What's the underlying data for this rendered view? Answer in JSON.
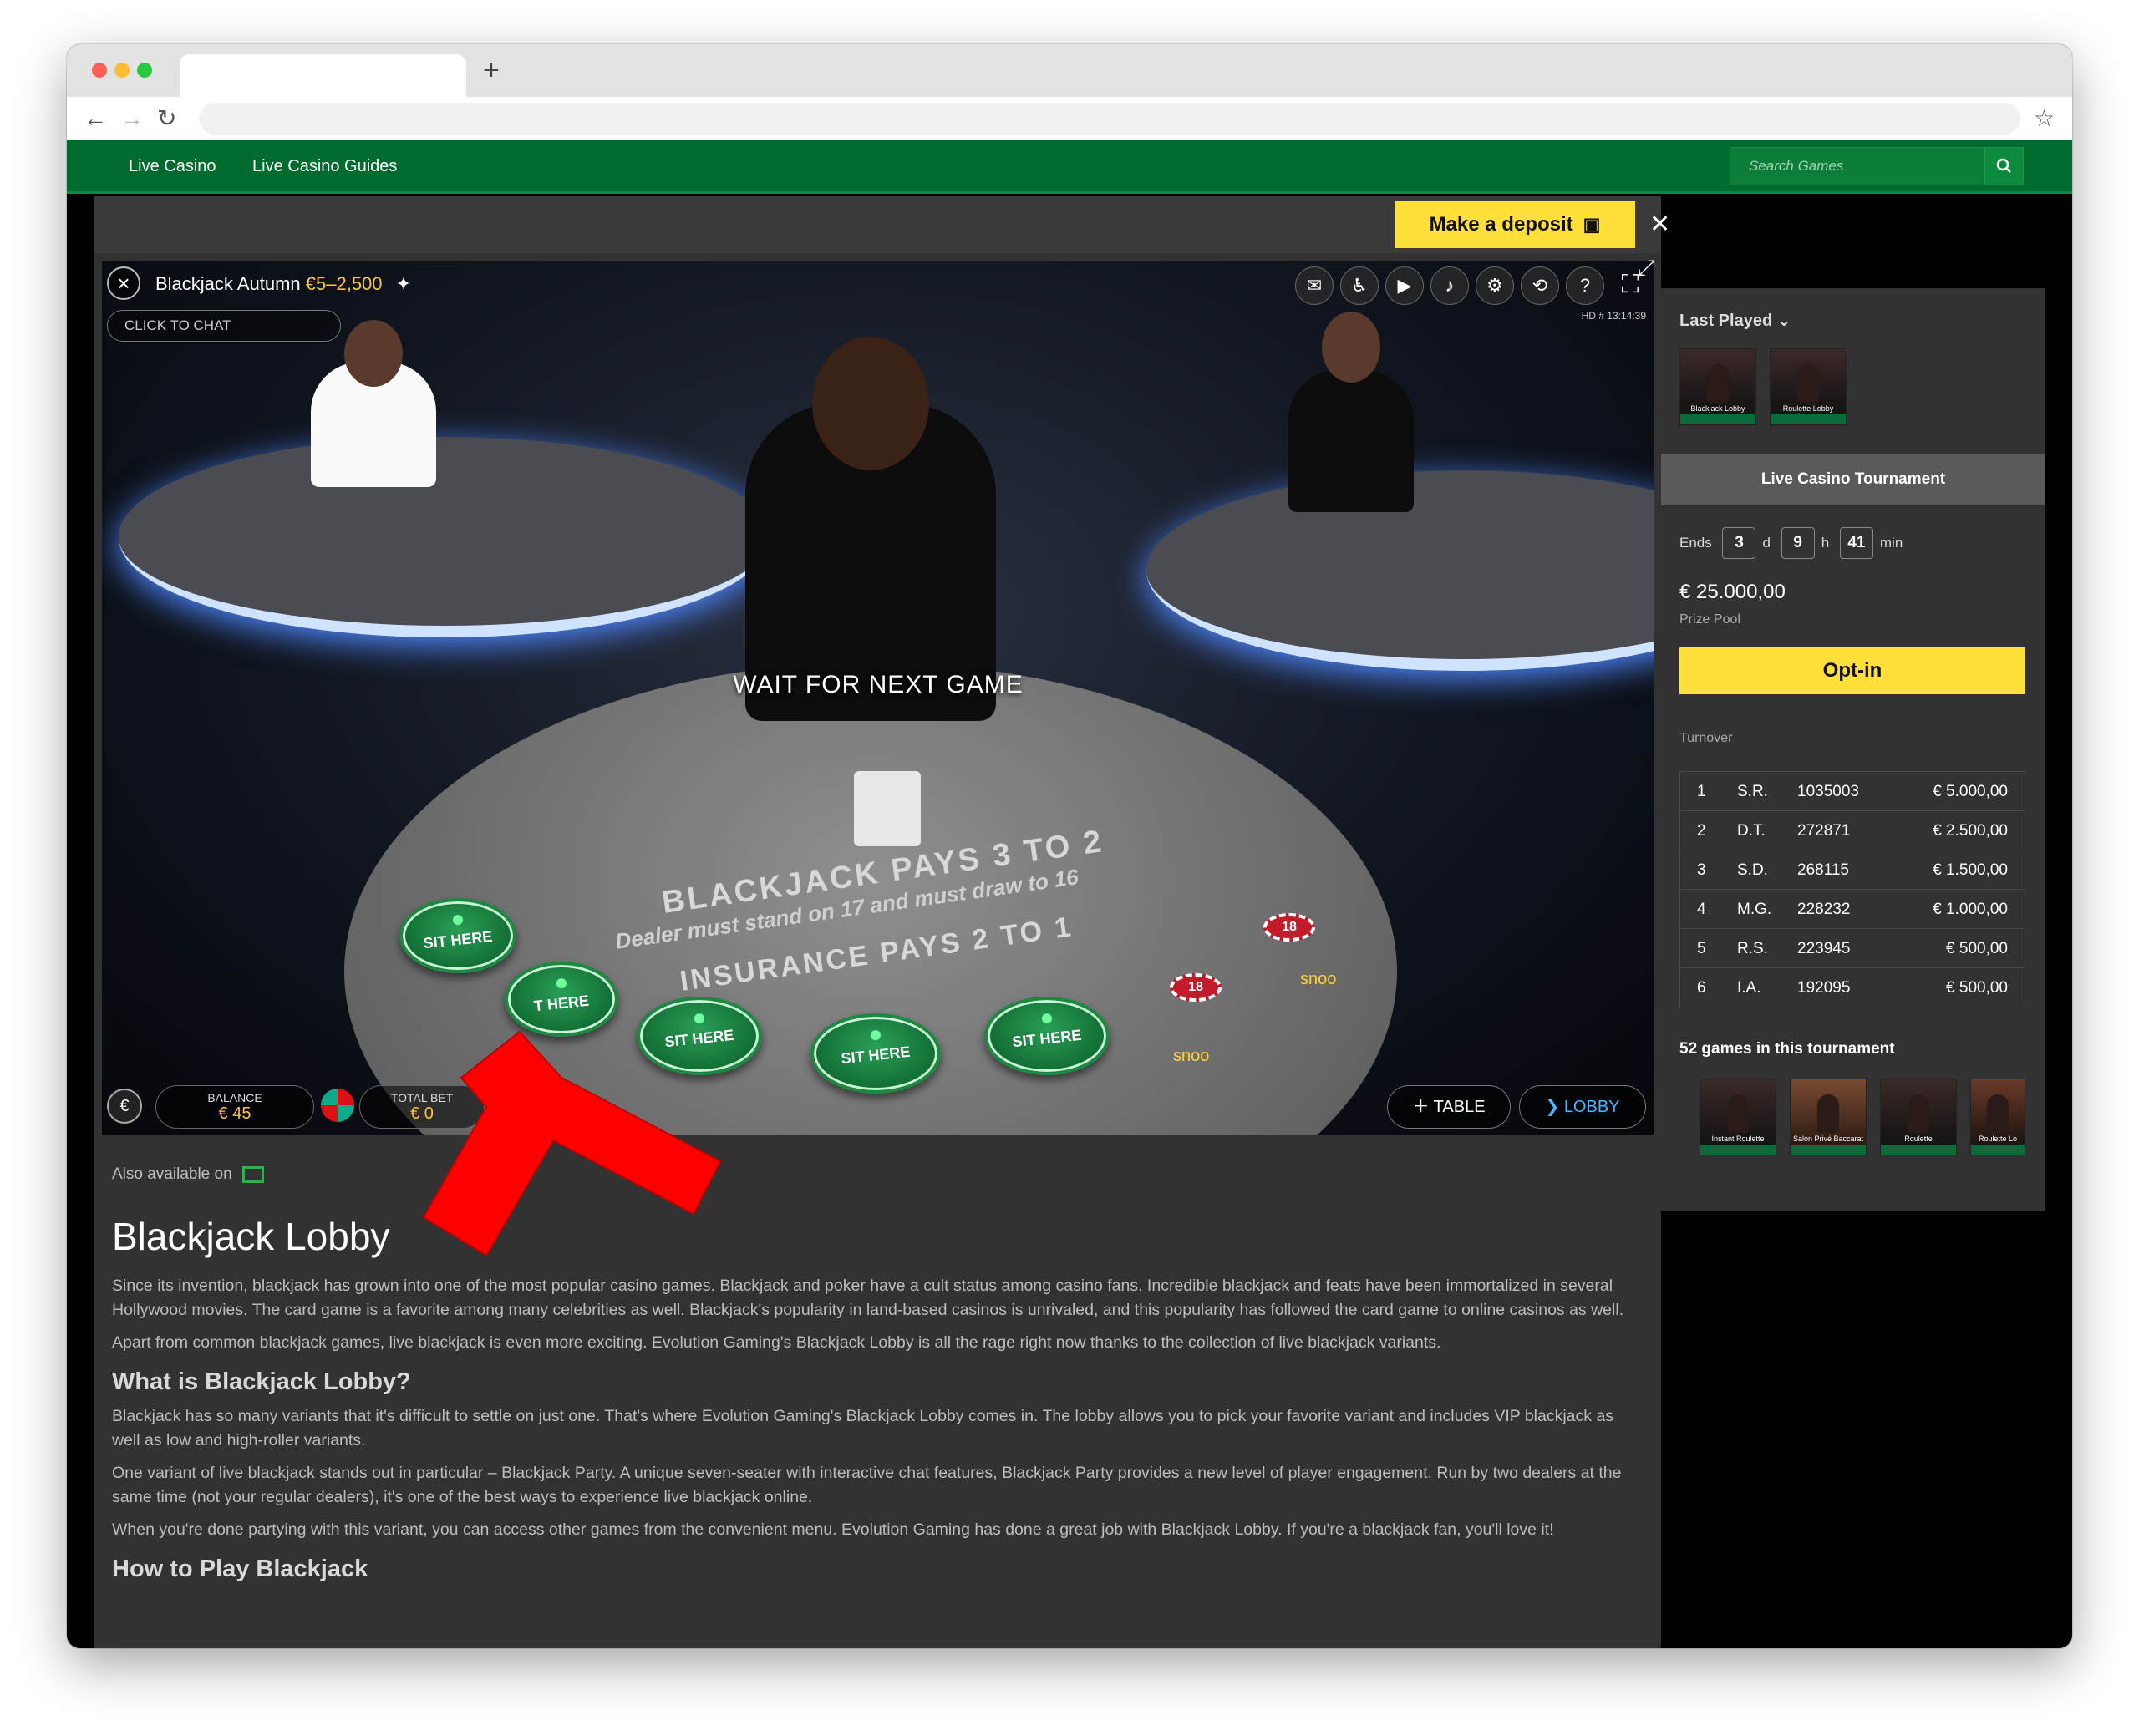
{
  "browser": {
    "new_tab_icon": "+",
    "back_icon": "←",
    "forward_icon": "→",
    "reload_icon": "↻",
    "bookmark_icon": "☆"
  },
  "site_nav": {
    "links": [
      "Live Casino",
      "Live Casino Guides"
    ],
    "search_placeholder": "Search Games",
    "search_icon": "search-icon"
  },
  "topbar": {
    "deposit_label": "Make a deposit",
    "close_icon": "✕"
  },
  "game": {
    "title": "Blackjack Autumn",
    "limits": "€5–2,500",
    "chat_placeholder": "CLICK TO CHAT",
    "hd_info": "HD  # 13:14:39",
    "status": "WAIT FOR NEXT GAME",
    "table_text_main": "BLACKJACK PAYS 3 TO 2",
    "table_text_rule": "Dealer must stand on 17 and must draw to 16",
    "table_text_ins": "INSURANCE PAYS 2 TO 1",
    "seat_label": "SIT HERE",
    "seat_partial_label": "T HERE",
    "chip_value": "18",
    "player_name": "snoo",
    "balance_label": "BALANCE",
    "balance_value": "€ 45",
    "total_bet_label": "TOTAL BET",
    "total_bet_value": "€ 0",
    "currency_icon": "€",
    "table_button": "TABLE",
    "lobby_button": "LOBBY"
  },
  "article": {
    "also_available": "Also available on",
    "title": "Blackjack Lobby",
    "p1": "Since its invention, blackjack has grown into one of the most popular casino games. Blackjack and poker have a cult status among casino fans. Incredible blackjack and feats have been immortalized in several Hollywood movies. The card game is a favorite among many celebrities as well. Blackjack's popularity in land-based casinos is unrivaled, and this popularity has followed the card game to online casinos as well.",
    "p2": "Apart from common blackjack games, live blackjack is even more exciting. Evolution Gaming's Blackjack Lobby is all the rage right now thanks to the collection of live blackjack variants.",
    "h2_1": "What is Blackjack Lobby?",
    "p3": "Blackjack has so many variants that it's difficult to settle on just one. That's where Evolution Gaming's Blackjack Lobby comes in. The lobby allows you to pick your favorite variant and includes VIP blackjack as well as low and high-roller variants.",
    "p4": "One variant of live blackjack stands out in particular – Blackjack Party. A unique seven-seater with interactive chat features, Blackjack Party provides a new level of player engagement. Run by two dealers at the same time (not your regular dealers), it's one of the best ways to experience live blackjack online.",
    "p5": "When you're done partying with this variant, you can access other games from the convenient menu. Evolution Gaming has done a great job with Blackjack Lobby. If you're a blackjack fan, you'll love it!",
    "h2_2": "How to Play Blackjack"
  },
  "sidebar": {
    "last_played": "Last Played",
    "last_played_items": [
      "Blackjack Lobby",
      "Roulette Lobby"
    ],
    "tournament_title": "Live Casino Tournament",
    "ends_label": "Ends",
    "days": "3",
    "days_unit": "d",
    "hours": "9",
    "hours_unit": "h",
    "minutes": "41",
    "minutes_unit": "min",
    "prize": "€ 25.000,00",
    "prize_label": "Prize Pool",
    "optin_label": "Opt-in",
    "turnover_label": "Turnover",
    "leaderboard": [
      {
        "rank": "1",
        "name": "S.R.",
        "id": "1035003",
        "amount": "€ 5.000,00"
      },
      {
        "rank": "2",
        "name": "D.T.",
        "id": "272871",
        "amount": "€ 2.500,00"
      },
      {
        "rank": "3",
        "name": "S.D.",
        "id": "268115",
        "amount": "€ 1.500,00"
      },
      {
        "rank": "4",
        "name": "M.G.",
        "id": "228232",
        "amount": "€ 1.000,00"
      },
      {
        "rank": "5",
        "name": "R.S.",
        "id": "223945",
        "amount": "€ 500,00"
      },
      {
        "rank": "6",
        "name": "I.A.",
        "id": "192095",
        "amount": "€ 500,00"
      }
    ],
    "games_count_label": "52 games in this tournament",
    "tournament_games": [
      "Instant Roulette",
      "Salon Privé Baccarat",
      "Roulette",
      "Roulette Lo"
    ]
  },
  "colors": {
    "brand_green": "#006b2e",
    "accent_yellow": "#ffe03b",
    "limit_orange": "#ffc43c",
    "annotation_red": "#ff0000"
  }
}
